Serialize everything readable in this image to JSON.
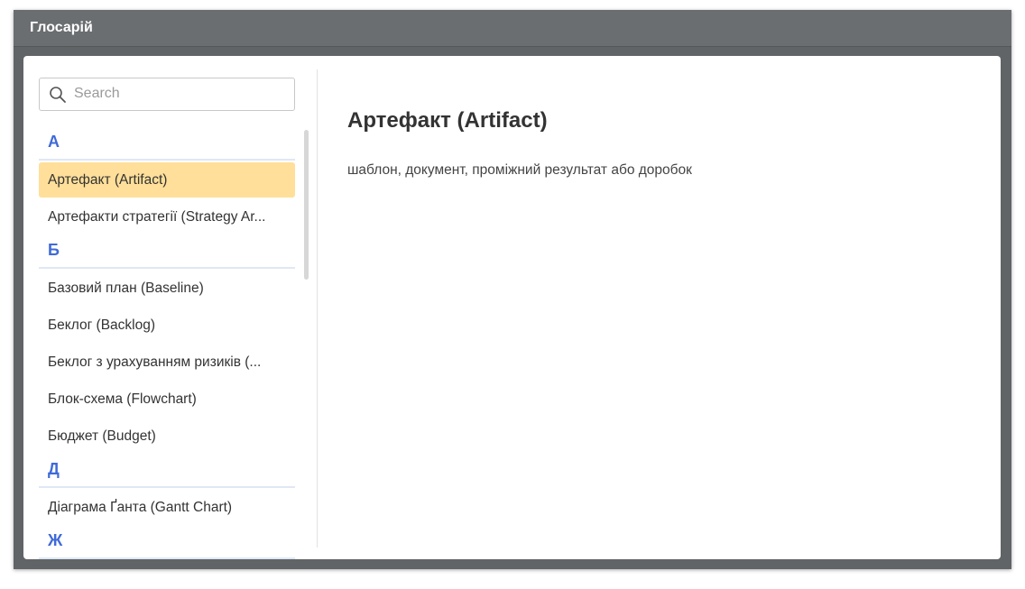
{
  "window": {
    "title": "Глосарій"
  },
  "search": {
    "placeholder": "Search",
    "icon": "search-icon"
  },
  "glossary": {
    "groups": [
      {
        "letter": "А",
        "items": [
          "Артефакт (Artifact)",
          "Артефакти стратегії (Strategy Ar..."
        ]
      },
      {
        "letter": "Б",
        "items": [
          "Базовий план (Baseline)",
          "Беклог (Backlog)",
          "Беклог з урахуванням ризиків (...",
          "Блок-схема (Flowchart)",
          "Бюджет (Budget)"
        ]
      },
      {
        "letter": "Д",
        "items": [
          "Діаграма Ґанта (Gantt Chart)"
        ]
      },
      {
        "letter": "Ж",
        "items": []
      }
    ],
    "selected": "Артефакт (Artifact)"
  },
  "detail": {
    "title": "Артефакт (Artifact)",
    "definition": "шаблон, документ, проміжний результат або доробок"
  },
  "colors": {
    "accent": "#3f6ad8",
    "selected_bg": "#ffdf99",
    "titlebar": "#6b6e70"
  }
}
